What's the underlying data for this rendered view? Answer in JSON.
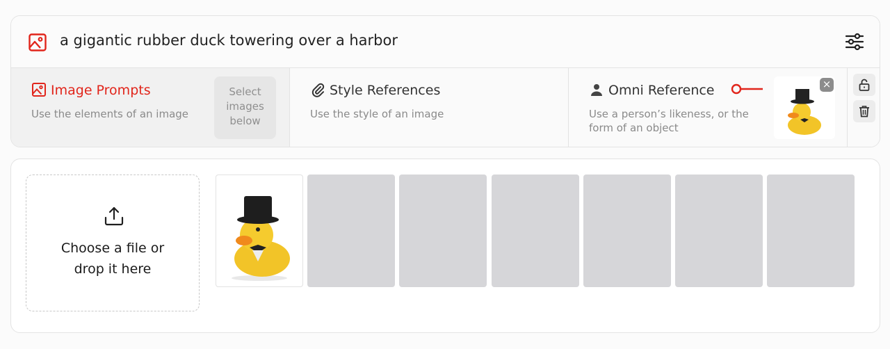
{
  "prompt": {
    "text": "a gigantic rubber duck towering over a harbor",
    "icon": "image-icon",
    "settings_icon": "sliders-icon"
  },
  "references": [
    {
      "title": "Image Prompts",
      "subtitle": "Use the elements of an image",
      "icon": "image-icon",
      "active": true,
      "placeholder": "Select images below"
    },
    {
      "title": "Style References",
      "subtitle": "Use the style of an image",
      "icon": "paperclip-icon",
      "active": false
    },
    {
      "title": "Omni Reference",
      "subtitle": "Use a person’s likeness, or the form of an object",
      "icon": "person-icon",
      "active": false
    }
  ],
  "side_actions": {
    "lock_icon": "unlock-icon",
    "delete_icon": "trash-icon"
  },
  "dropzone": {
    "text": "Choose a file or\ndrop it here",
    "icon": "upload-icon"
  },
  "gallery": {
    "slot_count": 7,
    "filled_slots": 1
  },
  "colors": {
    "accent": "#e1251b",
    "placeholder_tile": "#d6d6d9"
  }
}
